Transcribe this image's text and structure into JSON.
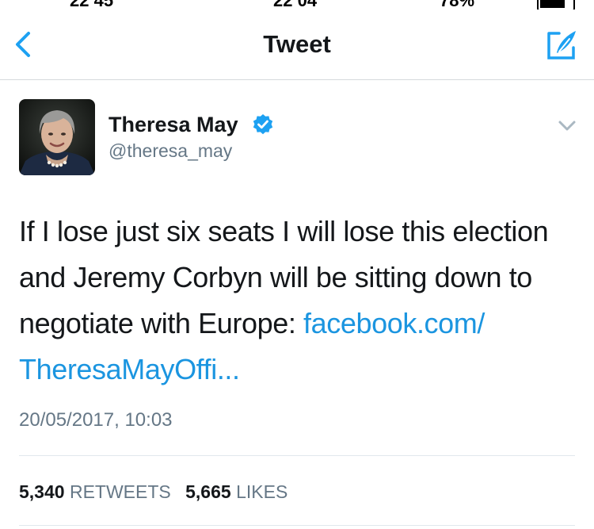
{
  "status_bar": {
    "left_text": "22 45",
    "center_text": "22 04",
    "right_text": "78%",
    "battery_level": 0.78
  },
  "nav": {
    "title": "Tweet",
    "back_icon": "chevron-left-icon",
    "compose_icon": "compose-tweet-icon",
    "accent_color": "#1da1f2"
  },
  "tweet": {
    "author_name": "Theresa May",
    "handle": "@theresa_may",
    "verified": true,
    "text_before_link": "If I lose just six seats I will lose this election and Jeremy Corbyn will be sitting down to negotiate with Europe: ",
    "link_text": "facebook.com/ TheresaMayOffi...",
    "timestamp": "20/05/2017, 10:03",
    "retweets_count": "5,340",
    "retweets_label": "RETWEETS",
    "likes_count": "5,665",
    "likes_label": "LIKES",
    "link_color": "#1b95e0"
  }
}
